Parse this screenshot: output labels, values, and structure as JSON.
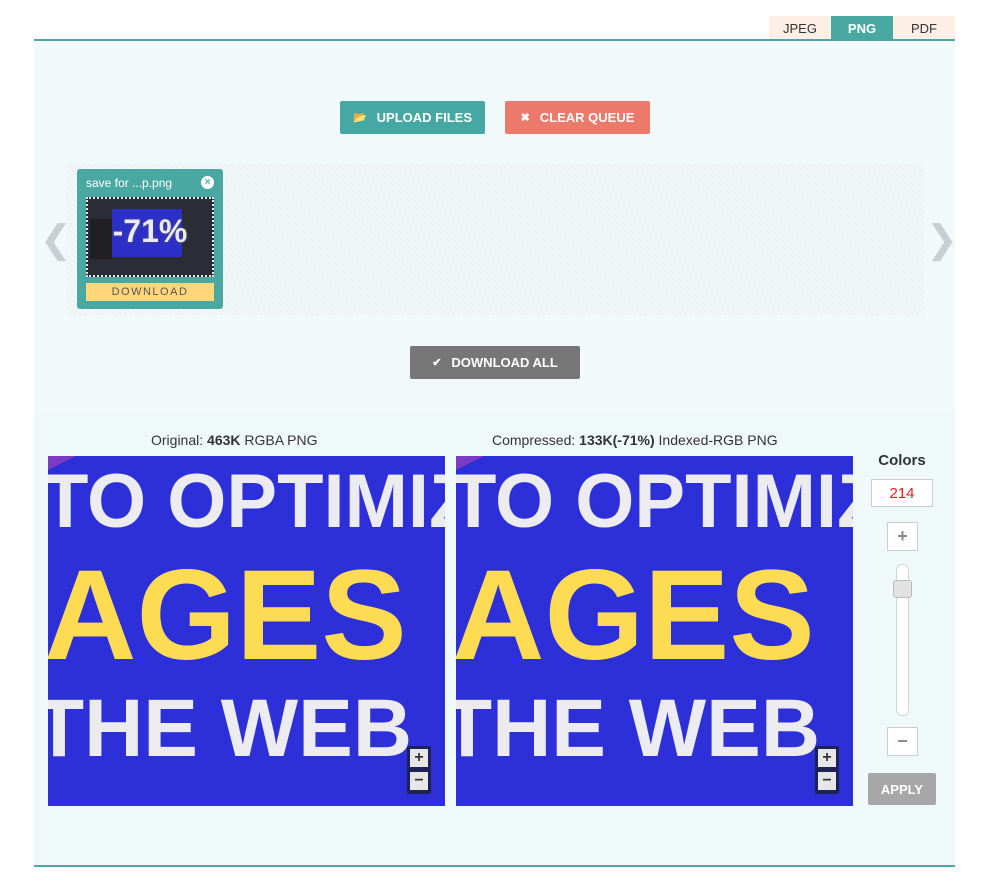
{
  "tabs": [
    {
      "label": "JPEG",
      "active": false
    },
    {
      "label": "PNG",
      "active": true
    },
    {
      "label": "PDF",
      "active": false
    }
  ],
  "actions": {
    "upload_label": "UPLOAD FILES",
    "clear_label": "CLEAR QUEUE",
    "download_all_label": "DOWNLOAD ALL"
  },
  "queue": {
    "prev_arrow": "❮",
    "next_arrow": "❯",
    "file": {
      "name": "save for ...p.png",
      "close": "×",
      "percent": "-71%",
      "download_label": "DOWNLOAD"
    }
  },
  "comparison": {
    "original": {
      "prefix": "Original: ",
      "size": "463K",
      "suffix": " RGBA PNG"
    },
    "compressed": {
      "prefix": "Compressed: ",
      "size": "133K(-71%)",
      "suffix": " Indexed-RGB PNG"
    },
    "preview_text": {
      "line1": "TO OPTIMIZ",
      "line2": "AGES",
      "line3": "THE WEB"
    },
    "zoom_in": "+",
    "zoom_out": "−"
  },
  "colors": {
    "title": "Colors",
    "value": "214",
    "plus": "+",
    "minus": "−",
    "apply_label": "APPLY"
  },
  "theme": {
    "accent": "#4aa8a3",
    "clear": "#ec7a6a",
    "download_all": "#777777",
    "preview_bg": "#2d2fd8",
    "preview_yellow": "#fddc54"
  }
}
